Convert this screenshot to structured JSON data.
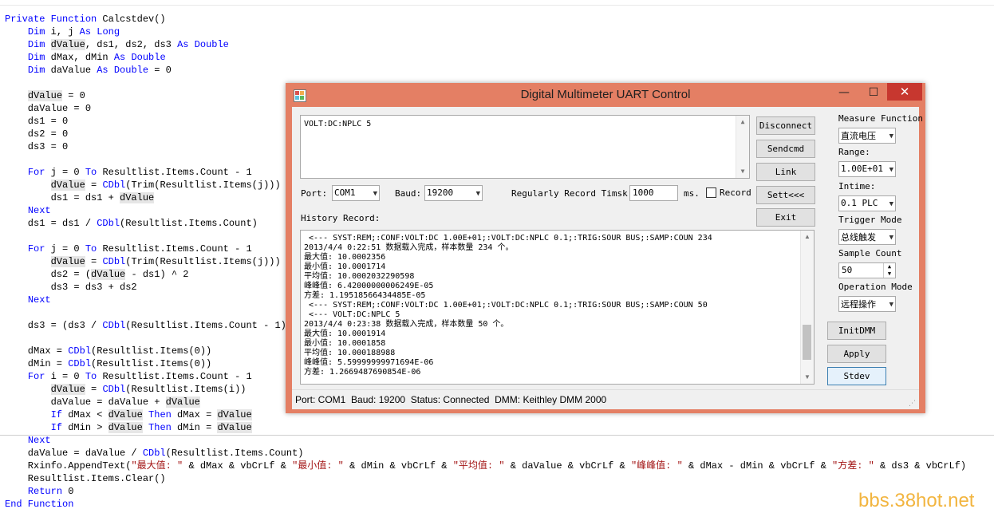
{
  "code": [
    {
      "segs": [
        {
          "k": 1,
          "t": "Private Function"
        },
        {
          "t": " Calcstdev()"
        }
      ]
    },
    {
      "segs": [
        {
          "t": "    "
        },
        {
          "k": 1,
          "t": "Dim"
        },
        {
          "t": " i, j "
        },
        {
          "k": 1,
          "t": "As Long"
        }
      ]
    },
    {
      "segs": [
        {
          "t": "    "
        },
        {
          "k": 1,
          "t": "Dim"
        },
        {
          "t": " "
        },
        {
          "h": 1,
          "t": "dValue"
        },
        {
          "t": ", ds1, ds2, ds3 "
        },
        {
          "k": 1,
          "t": "As Double"
        }
      ]
    },
    {
      "segs": [
        {
          "t": "    "
        },
        {
          "k": 1,
          "t": "Dim"
        },
        {
          "t": " dMax, dMin "
        },
        {
          "k": 1,
          "t": "As Double"
        }
      ]
    },
    {
      "segs": [
        {
          "t": "    "
        },
        {
          "k": 1,
          "t": "Dim"
        },
        {
          "t": " daValue "
        },
        {
          "k": 1,
          "t": "As Double"
        },
        {
          "t": " = 0"
        }
      ]
    },
    {
      "segs": []
    },
    {
      "segs": [
        {
          "t": "    "
        },
        {
          "h": 1,
          "t": "dValue"
        },
        {
          "t": " = 0"
        }
      ]
    },
    {
      "segs": [
        {
          "t": "    daValue = 0"
        }
      ]
    },
    {
      "segs": [
        {
          "t": "    ds1 = 0"
        }
      ]
    },
    {
      "segs": [
        {
          "t": "    ds2 = 0"
        }
      ]
    },
    {
      "segs": [
        {
          "t": "    ds3 = 0"
        }
      ]
    },
    {
      "segs": []
    },
    {
      "segs": [
        {
          "t": "    "
        },
        {
          "k": 1,
          "t": "For"
        },
        {
          "t": " j = 0 "
        },
        {
          "k": 1,
          "t": "To"
        },
        {
          "t": " Resultlist.Items.Count - 1"
        }
      ]
    },
    {
      "segs": [
        {
          "t": "        "
        },
        {
          "h": 1,
          "t": "dValue"
        },
        {
          "t": " = "
        },
        {
          "k": 1,
          "t": "CDbl"
        },
        {
          "t": "(Trim(Resultlist.Items(j)))"
        }
      ]
    },
    {
      "segs": [
        {
          "t": "        ds1 = ds1 + "
        },
        {
          "h": 1,
          "t": "dValue"
        }
      ]
    },
    {
      "segs": [
        {
          "t": "    "
        },
        {
          "k": 1,
          "t": "Next"
        }
      ]
    },
    {
      "segs": [
        {
          "t": "    ds1 = ds1 / "
        },
        {
          "k": 1,
          "t": "CDbl"
        },
        {
          "t": "(Resultlist.Items.Count)"
        }
      ]
    },
    {
      "segs": []
    },
    {
      "segs": [
        {
          "t": "    "
        },
        {
          "k": 1,
          "t": "For"
        },
        {
          "t": " j = 0 "
        },
        {
          "k": 1,
          "t": "To"
        },
        {
          "t": " Resultlist.Items.Count - 1"
        }
      ]
    },
    {
      "segs": [
        {
          "t": "        "
        },
        {
          "h": 1,
          "t": "dValue"
        },
        {
          "t": " = "
        },
        {
          "k": 1,
          "t": "CDbl"
        },
        {
          "t": "(Trim(Resultlist.Items(j)))"
        }
      ]
    },
    {
      "segs": [
        {
          "t": "        ds2 = ("
        },
        {
          "h": 1,
          "t": "dValue"
        },
        {
          "t": " - ds1) ^ 2"
        }
      ]
    },
    {
      "segs": [
        {
          "t": "        ds3 = ds3 + ds2"
        }
      ]
    },
    {
      "segs": [
        {
          "t": "    "
        },
        {
          "k": 1,
          "t": "Next"
        }
      ]
    },
    {
      "segs": []
    },
    {
      "segs": [
        {
          "t": "    ds3 = (ds3 / "
        },
        {
          "k": 1,
          "t": "CDbl"
        },
        {
          "t": "(Resultlist.Items.Count - 1))"
        }
      ]
    },
    {
      "segs": []
    },
    {
      "segs": [
        {
          "t": "    dMax = "
        },
        {
          "k": 1,
          "t": "CDbl"
        },
        {
          "t": "(Resultlist.Items(0))"
        }
      ]
    },
    {
      "segs": [
        {
          "t": "    dMin = "
        },
        {
          "k": 1,
          "t": "CDbl"
        },
        {
          "t": "(Resultlist.Items(0))"
        }
      ]
    },
    {
      "segs": [
        {
          "t": "    "
        },
        {
          "k": 1,
          "t": "For"
        },
        {
          "t": " i = 0 "
        },
        {
          "k": 1,
          "t": "To"
        },
        {
          "t": " Resultlist.Items.Count - 1"
        }
      ]
    },
    {
      "segs": [
        {
          "t": "        "
        },
        {
          "h": 1,
          "t": "dValue"
        },
        {
          "t": " = "
        },
        {
          "k": 1,
          "t": "CDbl"
        },
        {
          "t": "(Resultlist.Items(i))"
        }
      ]
    },
    {
      "segs": [
        {
          "t": "        daValue = daValue + "
        },
        {
          "h": 1,
          "t": "dValue"
        }
      ]
    },
    {
      "segs": [
        {
          "t": "        "
        },
        {
          "k": 1,
          "t": "If"
        },
        {
          "t": " dMax < "
        },
        {
          "h": 1,
          "t": "dValue"
        },
        {
          "t": " "
        },
        {
          "k": 1,
          "t": "Then"
        },
        {
          "t": " dMax = "
        },
        {
          "h": 1,
          "t": "dValue"
        }
      ]
    },
    {
      "segs": [
        {
          "t": "        "
        },
        {
          "k": 1,
          "t": "If"
        },
        {
          "t": " dMin > "
        },
        {
          "h": 1,
          "t": "dValue"
        },
        {
          "t": " "
        },
        {
          "k": 1,
          "t": "Then"
        },
        {
          "t": " dMin = "
        },
        {
          "h": 1,
          "t": "dValue"
        }
      ]
    },
    {
      "segs": [
        {
          "t": "    "
        },
        {
          "k": 1,
          "t": "Next"
        }
      ]
    },
    {
      "segs": [
        {
          "t": "    daValue = daValue / "
        },
        {
          "k": 1,
          "t": "CDbl"
        },
        {
          "t": "(Resultlist.Items.Count)"
        }
      ]
    },
    {
      "segs": [
        {
          "t": "    Rxinfo.AppendText("
        },
        {
          "s": 1,
          "t": "\"最大值: \""
        },
        {
          "t": " & dMax & vbCrLf & "
        },
        {
          "s": 1,
          "t": "\"最小值: \""
        },
        {
          "t": " & dMin & vbCrLf & "
        },
        {
          "s": 1,
          "t": "\"平均值: \""
        },
        {
          "t": " & daValue & vbCrLf & "
        },
        {
          "s": 1,
          "t": "\"峰峰值: \""
        },
        {
          "t": " & dMax - dMin & vbCrLf & "
        },
        {
          "s": 1,
          "t": "\"方差: \""
        },
        {
          "t": " & ds3 & vbCrLf)"
        }
      ]
    },
    {
      "segs": [
        {
          "t": "    Resultlist.Items.Clear()"
        }
      ]
    },
    {
      "segs": [
        {
          "t": "    "
        },
        {
          "k": 1,
          "t": "Return"
        },
        {
          "t": " 0"
        }
      ]
    },
    {
      "segs": [
        {
          "k": 1,
          "t": "End Function"
        }
      ]
    }
  ],
  "window": {
    "title": "Digital Multimeter UART Control",
    "minimize": "—",
    "maximize": "☐",
    "close": "✕"
  },
  "command_text": "VOLT:DC:NPLC 5",
  "buttons": {
    "disconnect": "Disconnect",
    "sendcmd": "Sendcmd",
    "link": "Link",
    "sett": "Sett<<<",
    "exit": "Exit",
    "initdmm": "InitDMM",
    "apply": "Apply",
    "stdev": "Stdev"
  },
  "port": {
    "label": "Port:",
    "value": "COM1"
  },
  "baud": {
    "label": "Baud:",
    "value": "19200"
  },
  "record_time": {
    "label": "Regularly Record Timsk:",
    "value": "1000",
    "unit": "ms."
  },
  "record": {
    "label": "Record",
    "checked": false
  },
  "history_label": "History Record:",
  "history": [
    " <--- SYST:REM;:CONF:VOLT:DC 1.00E+01;:VOLT:DC:NPLC 0.1;:TRIG:SOUR BUS;:SAMP:COUN 234",
    "2013/4/4 0:22:51 数据载入完成，样本数量 234 个。",
    "最大值: 10.0002356",
    "最小值: 10.0001714",
    "平均值: 10.0002032290598",
    "峰峰值: 6.42000000006249E-05",
    "方差: 1.19518566434485E-05",
    " <--- SYST:REM;:CONF:VOLT:DC 1.00E+01;:VOLT:DC:NPLC 0.1;:TRIG:SOUR BUS;:SAMP:COUN 50",
    " <--- VOLT:DC:NPLC 5",
    "2013/4/4 0:23:38 数据载入完成，样本数量 50 个。",
    "最大值: 10.0001914",
    "最小值: 10.0001858",
    "平均值: 10.000188988",
    "峰峰值: 5.59999999971694E-06",
    "方差: 1.2669487690854E-06"
  ],
  "right_panel": {
    "measure_function": {
      "label": "Measure Function",
      "value": "直流电压"
    },
    "range": {
      "label": "Range:",
      "value": "1.00E+01"
    },
    "intime": {
      "label": "Intime:",
      "value": "0.1 PLC"
    },
    "trigger_mode": {
      "label": "Trigger Mode",
      "value": "总线触发"
    },
    "sample_count": {
      "label": "Sample Count",
      "value": "50"
    },
    "operation_mode": {
      "label": "Operation Mode",
      "value": "远程操作"
    }
  },
  "status_bar": "Port: COM1  Baud: 19200  Status: Connected  DMM: Keithley DMM 2000",
  "watermark": "bbs.38hot.net",
  "colors": {
    "window_frame": "#e47f64",
    "keyword": "#0000ff",
    "close": "#c7372f",
    "watermark": "#f2b540"
  }
}
